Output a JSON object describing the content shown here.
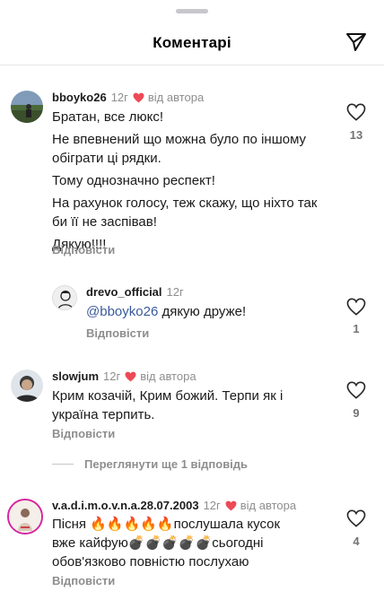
{
  "header": {
    "title": "Коментарі",
    "share_icon": "paper-plane-icon"
  },
  "comments": [
    {
      "username": "bboyko26",
      "time": "12г",
      "author_liked": "від автора",
      "lines": [
        "Братан, все люкс!",
        "Не впевнений що можна було по іншому обіграти ці рядки.",
        "Тому однозначно респект!",
        "На рахунок голосу, теж скажу, що ніхто так би її не заспівав!",
        "Дякую!!!!"
      ],
      "reply_label": "Відповісти",
      "likes": "13"
    },
    {
      "username": "drevo_official",
      "time": "12г",
      "mention": "@bboyko26",
      "text": " дякую друже!",
      "reply_label": "Відповісти",
      "likes": "1"
    },
    {
      "username": "slowjum",
      "time": "12г",
      "author_liked": "від автора",
      "text": "Крим козачій, Крим божий. Терпи як і україна терпить.",
      "reply_label": "Відповісти",
      "likes": "9"
    },
    {
      "username": "v.a.d.i.m.o.v.n.a.28.07.2003",
      "time": "12г",
      "author_liked": "від автора",
      "line1_start": "Пісня ",
      "line1_emojis": "🔥🔥🔥🔥🔥",
      "line1_end": "послушала кусок",
      "line2_start": "вже кайфую",
      "line2_emojis": "💣💣💣💣💣",
      "line2_end": "сьогодні",
      "line3": "обов'язково повністю послухаю",
      "reply_label": "Відповісти",
      "likes": "4"
    }
  ],
  "view_more": "Переглянути ще 1 відповідь",
  "colors": {
    "heart_red": "#ed4956",
    "secondary_text": "#8e8e8e",
    "mention": "#3a5a9c"
  }
}
